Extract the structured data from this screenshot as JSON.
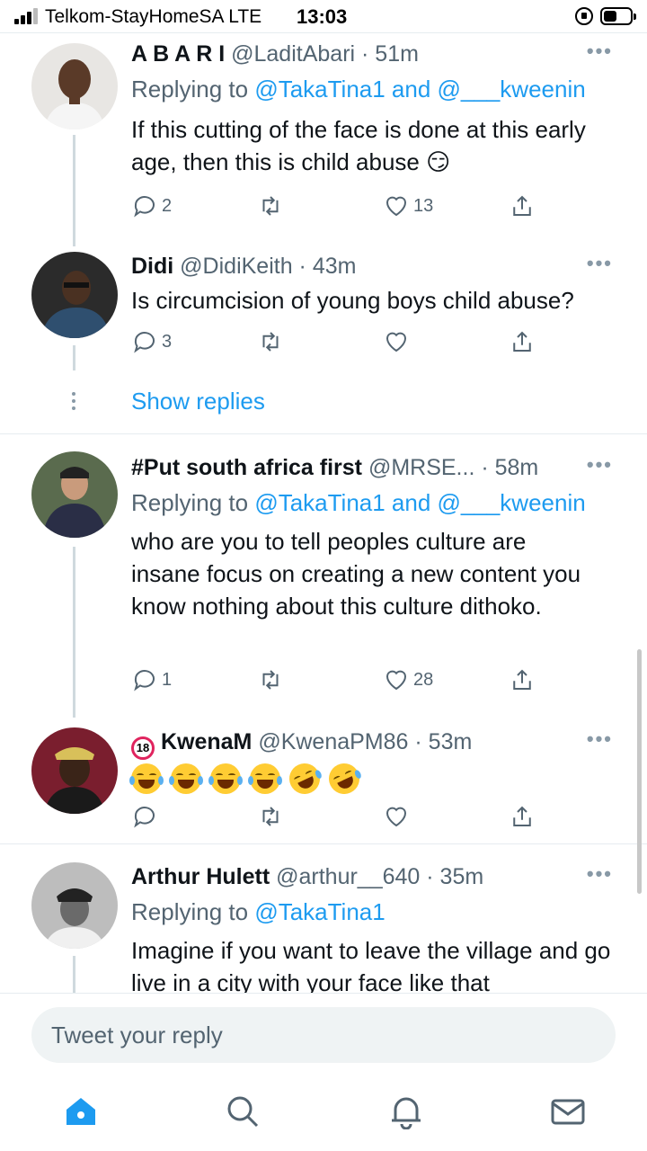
{
  "status_bar": {
    "carrier": "Telkom-StayHomeSA  LTE",
    "time": "13:03",
    "battery_level": 0.5
  },
  "tweets": [
    {
      "name": "A B A R I",
      "handle": "@LaditAbari",
      "time": "51m",
      "replying_prefix": "Replying to ",
      "replying_mentions": "@TakaTina1 and @___kweenin",
      "text": "If this cutting of the face is done at this early age, then this is child abuse 😏",
      "replies": "2",
      "retweets": "",
      "likes": "13"
    },
    {
      "name": "Didi",
      "handle": "@DidiKeith",
      "time": "43m",
      "text": "Is circumcision of young boys child abuse?",
      "replies": "3",
      "retweets": "",
      "likes": ""
    },
    {
      "name": "#Put south africa first",
      "handle": "@MRSE...",
      "time": "58m",
      "replying_prefix": "Replying to ",
      "replying_mentions": "@TakaTina1 and @___kweenin",
      "text": "who are you to tell peoples culture are insane focus on creating a new content you know nothing about this culture dithoko.",
      "replies": "1",
      "retweets": "",
      "likes": "28"
    },
    {
      "name": "KwenaM",
      "name_badge": "18",
      "handle": "@KwenaPM86",
      "time": "53m",
      "emojis": [
        "joy",
        "joy",
        "joy",
        "joy",
        "rofl",
        "rofl"
      ],
      "replies": "",
      "retweets": "",
      "likes": ""
    },
    {
      "name": "Arthur Hulett",
      "handle": "@arthur__640",
      "time": "35m",
      "replying_prefix": "Replying to ",
      "replying_mentions": "@TakaTina1",
      "text": "Imagine if you want to leave the village and go live in a city with your face like that"
    }
  ],
  "show_replies": "Show replies",
  "more_glyph": "•••",
  "dot_sep": " · ",
  "compose": {
    "placeholder": "Tweet your reply"
  },
  "tabbar": [
    "home-icon",
    "search-icon",
    "notifications-icon",
    "messages-icon"
  ],
  "colors": {
    "accent": "#1d9bf0",
    "muted": "#536471",
    "divider": "#e6ecf0"
  }
}
